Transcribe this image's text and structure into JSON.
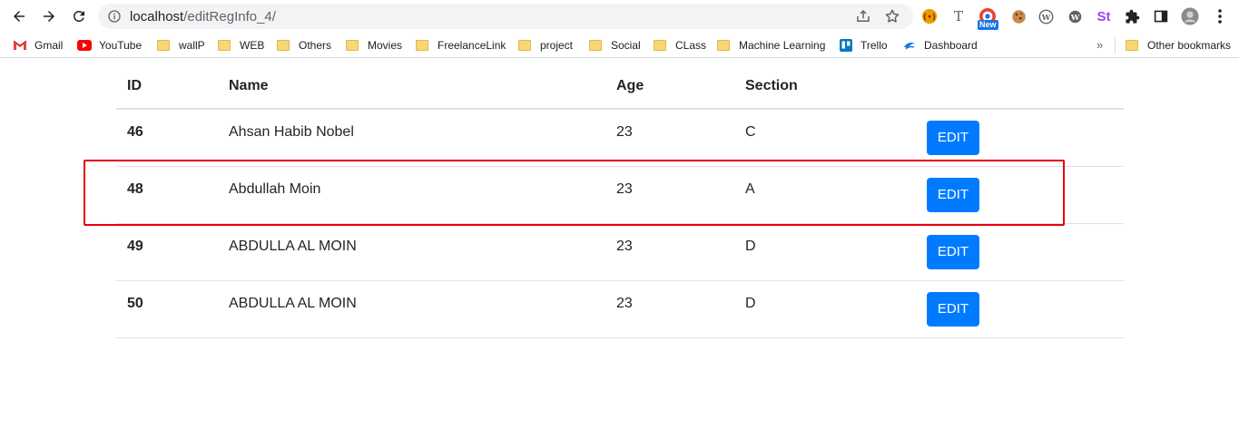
{
  "browser": {
    "url_host": "localhost",
    "url_path": "/editRegInfo_4/",
    "extension_badge": "New",
    "extensions": [
      "t-ext-icon",
      "new-badge-ext-icon",
      "cookie-icon",
      "wordpress-icon",
      "wordpress2-icon",
      "st-icon",
      "puzzle-icon",
      "sidepanel-icon",
      "profile-avatar",
      "menu-icon"
    ],
    "st_label": "St",
    "t_label": "T"
  },
  "bookmarks": {
    "items": [
      {
        "label": "Gmail",
        "icon": "gmail-icon"
      },
      {
        "label": "YouTube",
        "icon": "youtube-icon"
      },
      {
        "label": "wallP",
        "icon": "folder-icon"
      },
      {
        "label": "WEB",
        "icon": "folder-icon"
      },
      {
        "label": "Others",
        "icon": "folder-icon"
      },
      {
        "label": "Movies",
        "icon": "folder-icon"
      },
      {
        "label": "FreelanceLink",
        "icon": "folder-icon"
      },
      {
        "label": "project",
        "icon": "folder-icon"
      },
      {
        "label": "Social",
        "icon": "folder-icon"
      },
      {
        "label": "CLass",
        "icon": "folder-icon"
      },
      {
        "label": "Machine Learning",
        "icon": "folder-icon"
      },
      {
        "label": "Trello",
        "icon": "trello-icon"
      },
      {
        "label": "Dashboard",
        "icon": "dashboard-icon"
      }
    ],
    "overflow": "»",
    "other": "Other bookmarks"
  },
  "table": {
    "headers": {
      "id": "ID",
      "name": "Name",
      "age": "Age",
      "section": "Section"
    },
    "rows": [
      {
        "id": "46",
        "name": "Ahsan Habib Nobel",
        "age": "23",
        "section": "C",
        "action": "EDIT"
      },
      {
        "id": "48",
        "name": "Abdullah Moin",
        "age": "23",
        "section": "A",
        "action": "EDIT"
      },
      {
        "id": "49",
        "name": "ABDULLA AL MOIN",
        "age": "23",
        "section": "D",
        "action": "EDIT"
      },
      {
        "id": "50",
        "name": "ABDULLA AL MOIN",
        "age": "23",
        "section": "D",
        "action": "EDIT"
      }
    ]
  },
  "colors": {
    "edit_button": "#007bff",
    "highlight_border": "#e3000f"
  }
}
